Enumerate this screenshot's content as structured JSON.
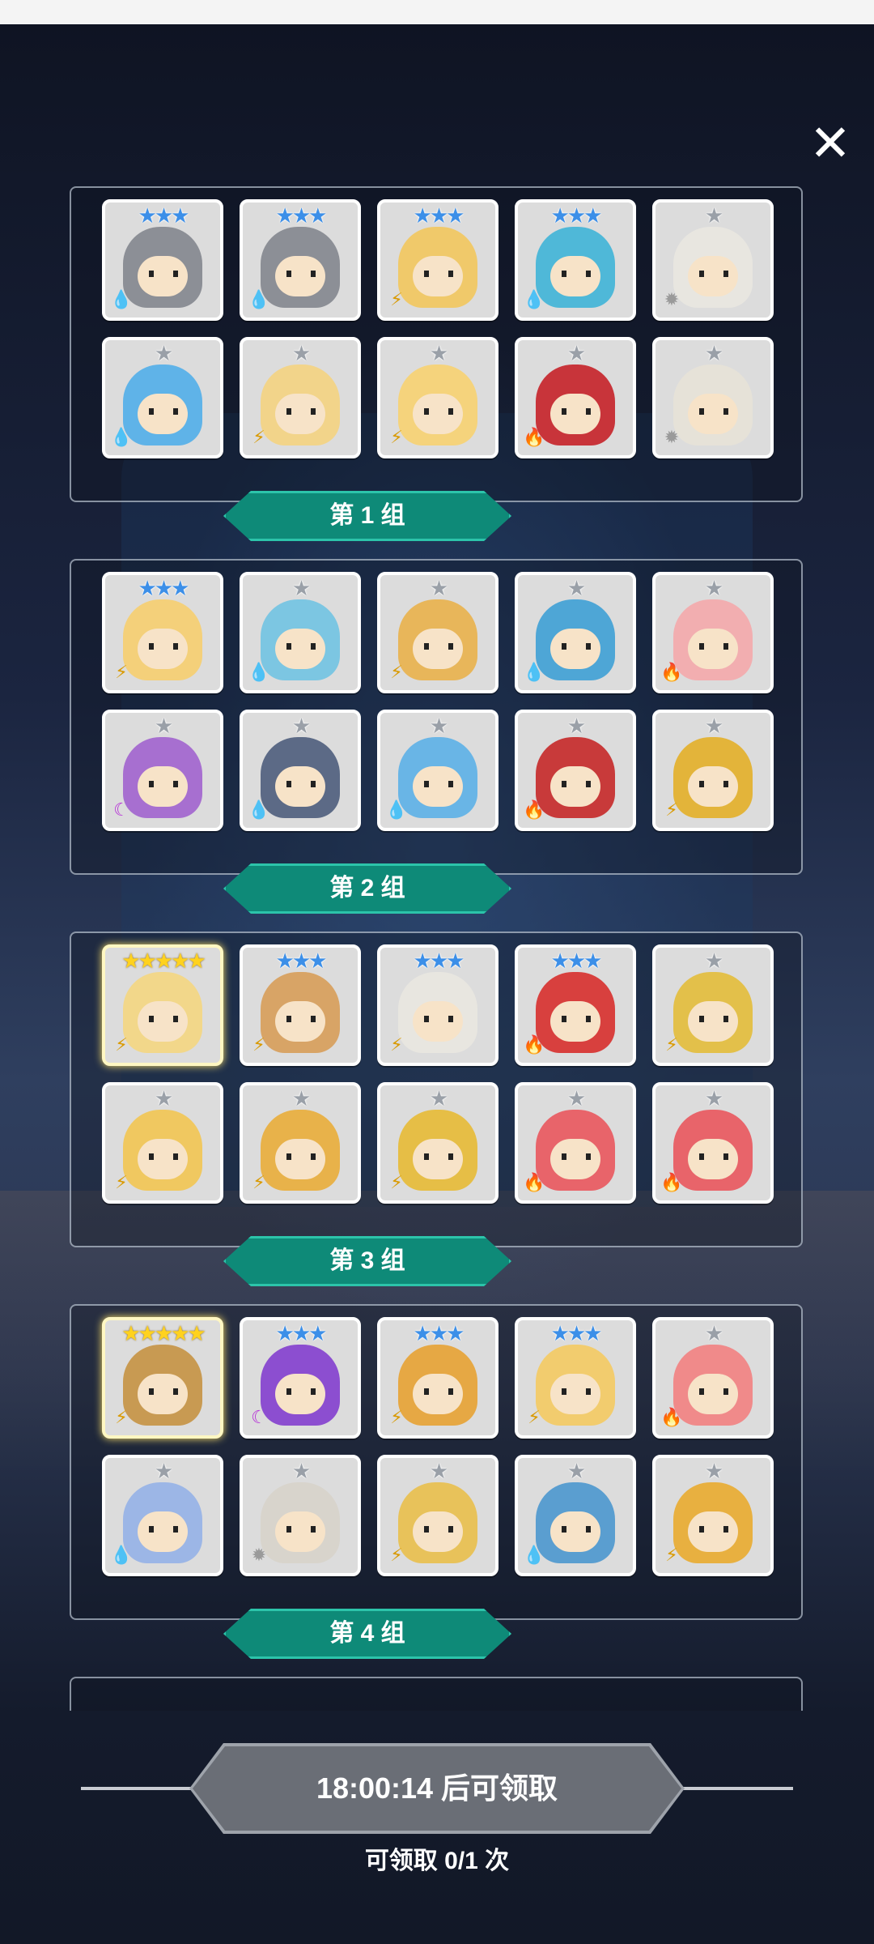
{
  "close_icon": "close-icon",
  "groups": [
    {
      "label": "第 1 组",
      "heroes": [
        {
          "stars": "★★★",
          "tier": "blue",
          "element": "water",
          "color": "#8c8f96"
        },
        {
          "stars": "★★★",
          "tier": "blue",
          "element": "water",
          "color": "#8c8f96"
        },
        {
          "stars": "★★★",
          "tier": "blue",
          "element": "thunder",
          "color": "#f0c96a"
        },
        {
          "stars": "★★★",
          "tier": "blue",
          "element": "water",
          "color": "#4fb8d8"
        },
        {
          "stars": "★",
          "tier": "gray",
          "element": "light",
          "color": "#e8e6e0"
        },
        {
          "stars": "★",
          "tier": "gray",
          "element": "water",
          "color": "#5fb3e8"
        },
        {
          "stars": "★",
          "tier": "gray",
          "element": "thunder",
          "color": "#f2d48a"
        },
        {
          "stars": "★",
          "tier": "gray",
          "element": "thunder",
          "color": "#f5d37c"
        },
        {
          "stars": "★",
          "tier": "gray",
          "element": "fire",
          "color": "#c8343a"
        },
        {
          "stars": "★",
          "tier": "gray",
          "element": "light",
          "color": "#e6e2d8"
        }
      ]
    },
    {
      "label": "第 2 组",
      "heroes": [
        {
          "stars": "★★★",
          "tier": "blue",
          "element": "thunder",
          "color": "#f4d07a"
        },
        {
          "stars": "★",
          "tier": "gray",
          "element": "water",
          "color": "#7cc6e2"
        },
        {
          "stars": "★",
          "tier": "gray",
          "element": "thunder",
          "color": "#e8b65a"
        },
        {
          "stars": "★",
          "tier": "gray",
          "element": "water",
          "color": "#4ea6d6"
        },
        {
          "stars": "★",
          "tier": "gray",
          "element": "fire",
          "color": "#f2aeb0"
        },
        {
          "stars": "★",
          "tier": "gray",
          "element": "dark",
          "color": "#a76fd0"
        },
        {
          "stars": "★",
          "tier": "gray",
          "element": "water",
          "color": "#5c6a86"
        },
        {
          "stars": "★",
          "tier": "gray",
          "element": "water",
          "color": "#69b5e6"
        },
        {
          "stars": "★",
          "tier": "gray",
          "element": "fire",
          "color": "#c83a3a"
        },
        {
          "stars": "★",
          "tier": "gray",
          "element": "thunder",
          "color": "#e3b43a"
        }
      ]
    },
    {
      "label": "第 3 组",
      "heroes": [
        {
          "stars": "★★★★★",
          "tier": "gold",
          "element": "thunder",
          "color": "#f2d78a"
        },
        {
          "stars": "★★★",
          "tier": "blue",
          "element": "thunder",
          "color": "#d8a466"
        },
        {
          "stars": "★★★",
          "tier": "blue",
          "element": "thunder",
          "color": "#e8e6e0"
        },
        {
          "stars": "★★★",
          "tier": "blue",
          "element": "fire",
          "color": "#d8403e"
        },
        {
          "stars": "★",
          "tier": "gray",
          "element": "thunder",
          "color": "#e3c04a"
        },
        {
          "stars": "★",
          "tier": "gray",
          "element": "thunder",
          "color": "#f0c860"
        },
        {
          "stars": "★",
          "tier": "gray",
          "element": "thunder",
          "color": "#e8b24a"
        },
        {
          "stars": "★",
          "tier": "gray",
          "element": "thunder",
          "color": "#e6be46"
        },
        {
          "stars": "★",
          "tier": "gray",
          "element": "fire",
          "color": "#e8646a"
        },
        {
          "stars": "★",
          "tier": "gray",
          "element": "fire",
          "color": "#e8646a"
        }
      ]
    },
    {
      "label": "第 4 组",
      "heroes": [
        {
          "stars": "★★★★★",
          "tier": "gold",
          "element": "thunder",
          "color": "#c89a52"
        },
        {
          "stars": "★★★",
          "tier": "blue",
          "element": "dark",
          "color": "#8c4ed0"
        },
        {
          "stars": "★★★",
          "tier": "blue",
          "element": "thunder",
          "color": "#e6a844"
        },
        {
          "stars": "★★★",
          "tier": "blue",
          "element": "thunder",
          "color": "#f2cc6e"
        },
        {
          "stars": "★",
          "tier": "gray",
          "element": "fire",
          "color": "#f08a8a"
        },
        {
          "stars": "★",
          "tier": "gray",
          "element": "water",
          "color": "#9cb6e6"
        },
        {
          "stars": "★",
          "tier": "gray",
          "element": "light",
          "color": "#d8d4cc"
        },
        {
          "stars": "★",
          "tier": "gray",
          "element": "thunder",
          "color": "#e8c25a"
        },
        {
          "stars": "★",
          "tier": "gray",
          "element": "water",
          "color": "#5a9ed0"
        },
        {
          "stars": "★",
          "tier": "gray",
          "element": "thunder",
          "color": "#e8b040"
        }
      ]
    }
  ],
  "claim_button": {
    "label": "18:00:14 后可领取"
  },
  "claim_count": "可领取 0/1 次"
}
